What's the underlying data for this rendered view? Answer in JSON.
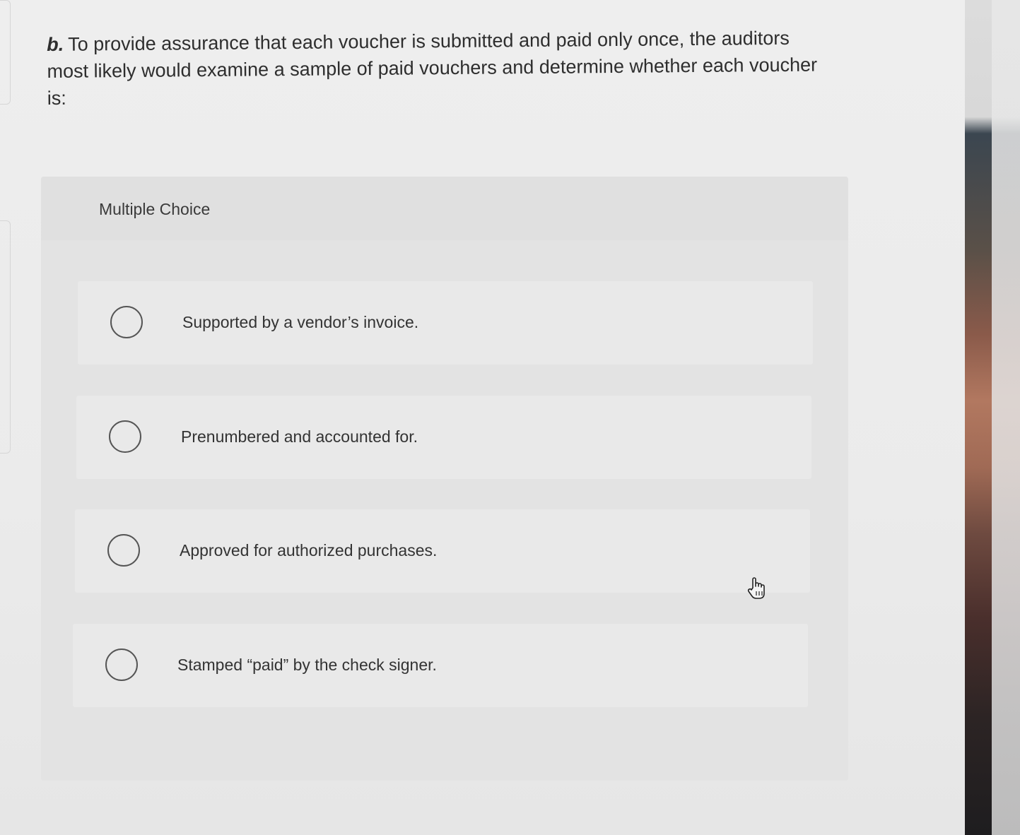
{
  "question": {
    "label": "b.",
    "text": "To provide assurance that each voucher is submitted and paid only once, the auditors most likely would examine a sample of paid vouchers and determine whether each voucher is:"
  },
  "multiple_choice": {
    "title": "Multiple Choice",
    "options": [
      {
        "label": "Supported by a vendor’s invoice.",
        "selected": false
      },
      {
        "label": "Prenumbered and accounted for.",
        "selected": false
      },
      {
        "label": "Approved for authorized purchases.",
        "selected": false
      },
      {
        "label": "Stamped “paid” by the check signer.",
        "selected": false
      }
    ]
  },
  "icons": {
    "radio": "radio-unchecked-icon",
    "pointer": "hand-pointer-icon"
  },
  "colors": {
    "panel_background": "#e3e3e3",
    "option_background": "#e9e9e9",
    "radio_border": "#555555",
    "text": "#333333"
  }
}
